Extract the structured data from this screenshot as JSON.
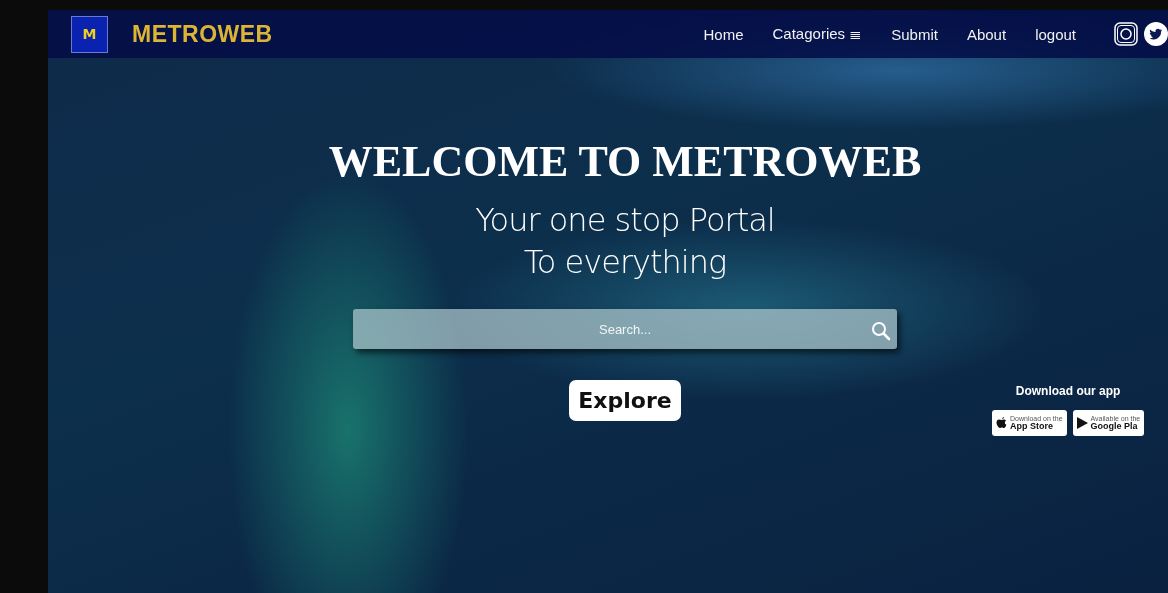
{
  "brand": {
    "name": "METROWEB",
    "logo_letter": "M"
  },
  "nav": {
    "items": [
      {
        "label": "Home"
      },
      {
        "label": "Catagories",
        "menu_glyph": "≣"
      },
      {
        "label": "Submit"
      },
      {
        "label": "About"
      },
      {
        "label": "logout"
      }
    ]
  },
  "hero": {
    "title": "WELCOME TO METROWEB",
    "subtitle_lines": [
      "Your one stop Portal",
      "To everything"
    ],
    "search": {
      "placeholder": "Search..."
    },
    "explore_button": "Explore"
  },
  "download": {
    "heading": "Download our app",
    "badges": [
      {
        "kind": "apple",
        "small": "Download on the",
        "big": "App Store"
      },
      {
        "kind": "google",
        "small": "Available on the",
        "big": "Google Pla"
      }
    ]
  }
}
